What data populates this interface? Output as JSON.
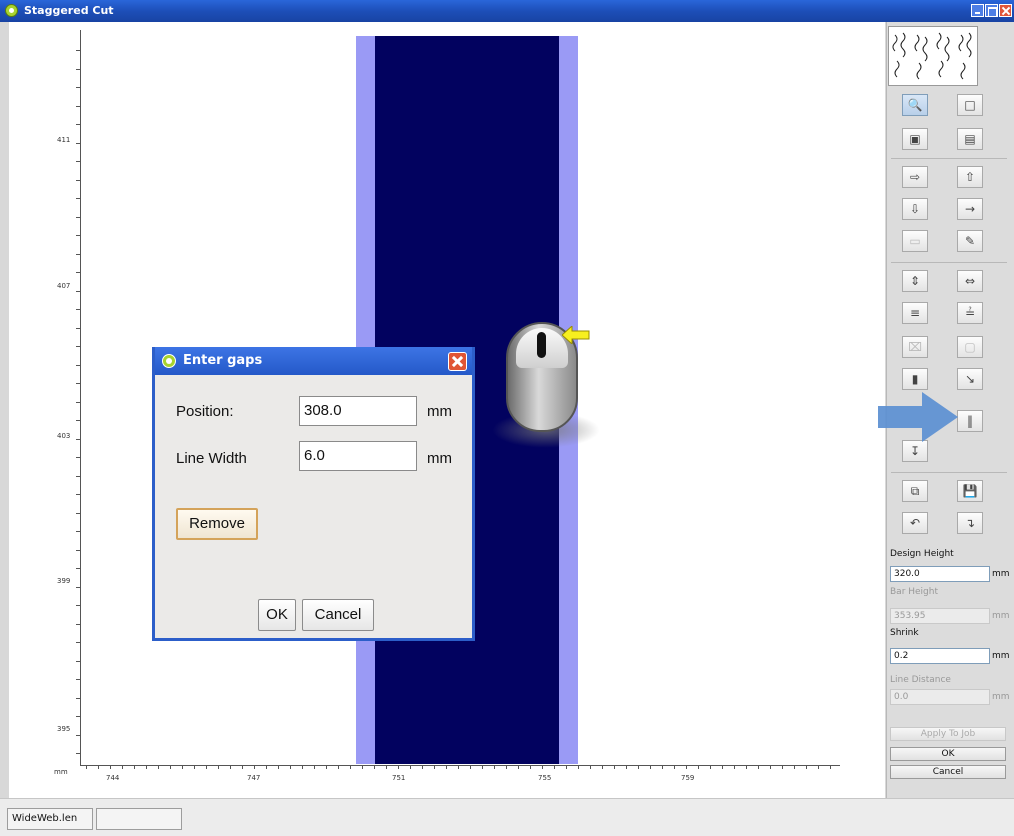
{
  "window": {
    "title": "Staggered Cut"
  },
  "ruler": {
    "unit": "mm",
    "y_ticks": [
      "411",
      "407",
      "403",
      "399",
      "395"
    ],
    "x_ticks": [
      "744",
      "747",
      "751",
      "755",
      "759"
    ]
  },
  "dialog": {
    "title": "Enter gaps",
    "position_label": "Position:",
    "position_value": "308.0",
    "position_unit": "mm",
    "linewidth_label": "Line Width",
    "linewidth_value": "6.0",
    "linewidth_unit": "mm",
    "remove_label": "Remove",
    "ok_label": "OK",
    "cancel_label": "Cancel"
  },
  "panel": {
    "design_height_label": "Design Height",
    "design_height_value": "320.0",
    "design_height_unit": "mm",
    "bar_height_label": "Bar Height",
    "bar_height_value": "353.95",
    "bar_height_unit": "mm",
    "shrink_label": "Shrink",
    "shrink_value": "0.2",
    "shrink_unit": "mm",
    "line_distance_label": "Line Distance",
    "line_distance_value": "0.0",
    "line_distance_unit": "mm",
    "apply_label": "Apply To Job",
    "ok_label": "OK",
    "cancel_label": "Cancel"
  },
  "statusbar": {
    "file": "WideWeb.len",
    "second": ""
  },
  "colors": {
    "band_dark": "#02025f",
    "band_light": "#9a9af5",
    "titlebar": "#2459c8"
  }
}
